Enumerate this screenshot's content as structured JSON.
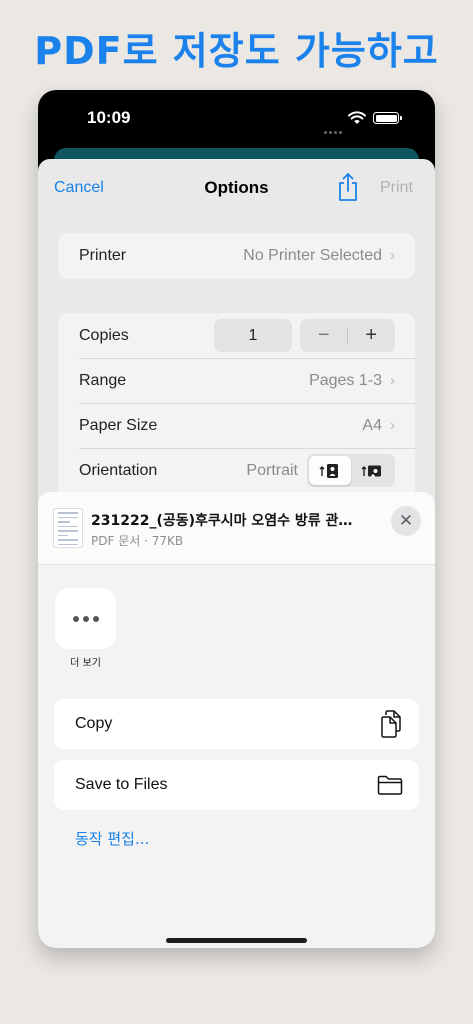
{
  "headline": "PDF로 저장도 가능하고",
  "status_bar": {
    "time": "10:09"
  },
  "options": {
    "cancel": "Cancel",
    "title": "Options",
    "print": "Print",
    "printer_label": "Printer",
    "printer_value": "No Printer Selected",
    "copies_label": "Copies",
    "copies_value": "1",
    "stepper_minus": "−",
    "stepper_plus": "+",
    "range_label": "Range",
    "range_value": "Pages 1-3",
    "paper_label": "Paper Size",
    "paper_value": "A4",
    "orientation_label": "Orientation",
    "orientation_value": "Portrait",
    "chevron": "›"
  },
  "share": {
    "file_name": "231222_(공동)후쿠시마 오염수 방류 관…",
    "file_meta": "PDF 문서 · 77KB",
    "close": "✕",
    "more_label": "더 보기",
    "copy_label": "Copy",
    "save_files_label": "Save to Files",
    "edit_actions": "동작 편집..."
  },
  "colors": {
    "accent": "#1a82ea",
    "background": "#ebe8e4"
  }
}
